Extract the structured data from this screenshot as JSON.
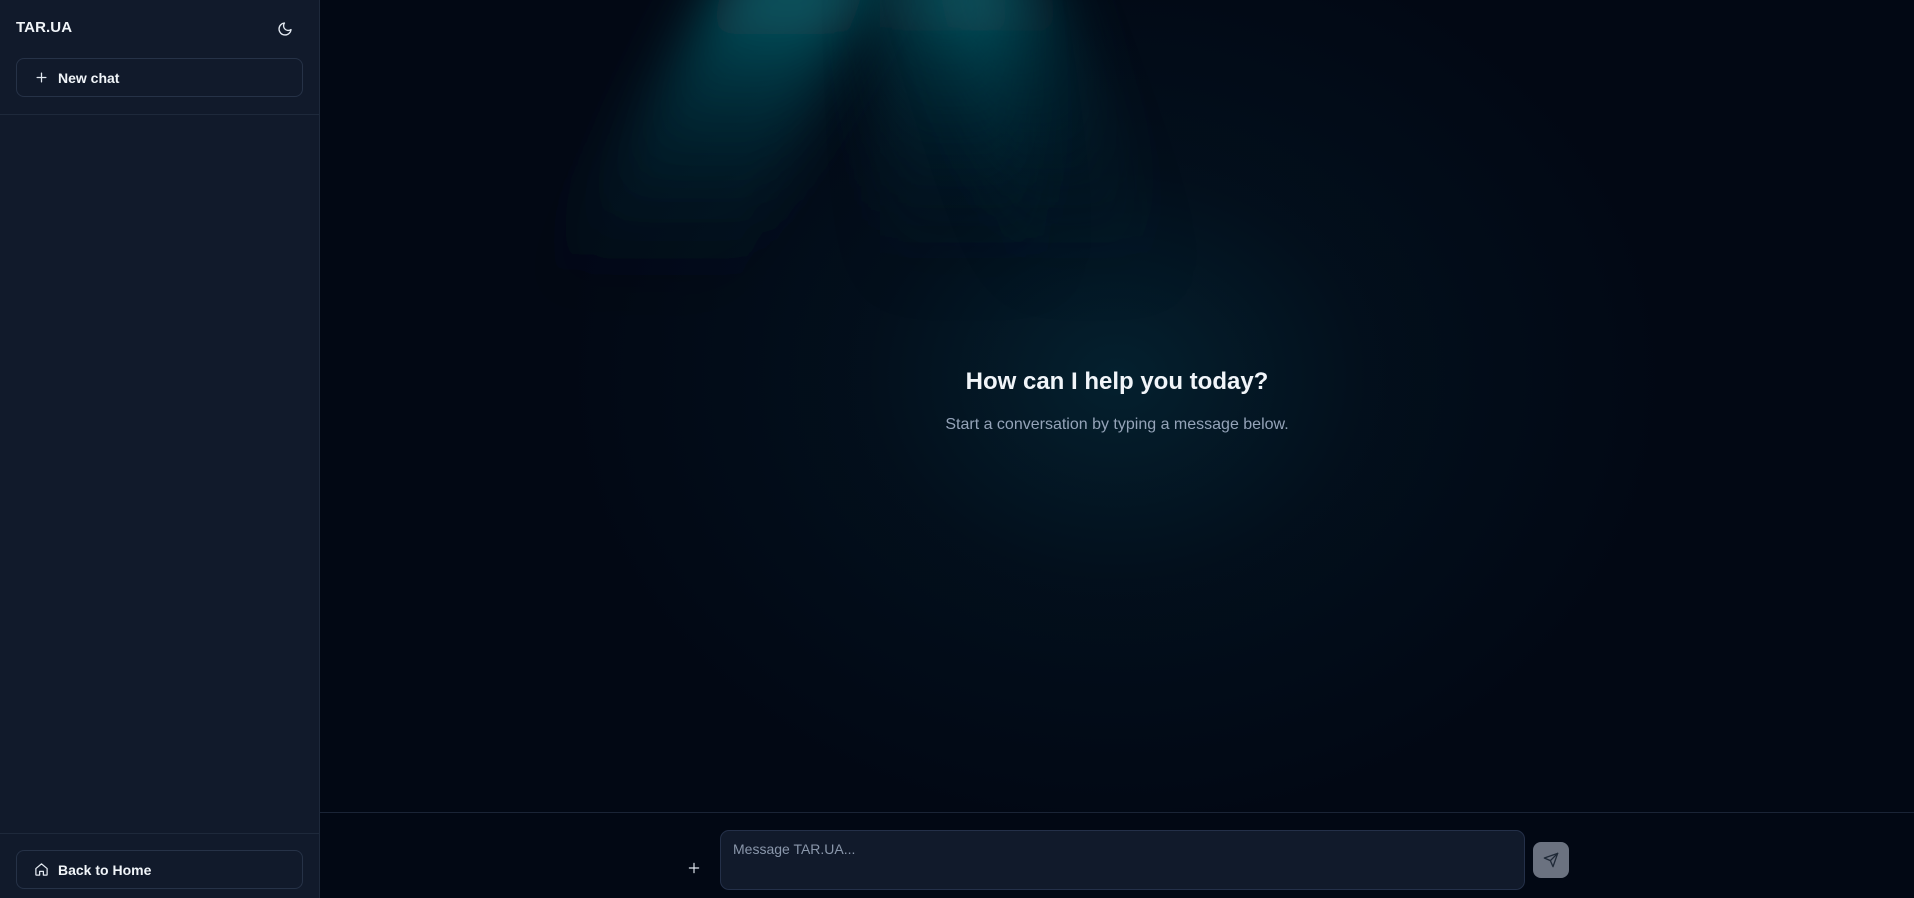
{
  "app": {
    "brand": "TAR.UA"
  },
  "sidebar": {
    "new_chat_label": "New chat",
    "back_home_label": "Back to Home",
    "icons": {
      "theme_toggle": "moon-icon",
      "new_chat": "plus-icon",
      "back_home": "home-icon"
    }
  },
  "main": {
    "title": "How can I help you today?",
    "subtitle": "Start a conversation by typing a message below."
  },
  "composer": {
    "placeholder": "Message TAR.UA...",
    "value": "",
    "icons": {
      "attach": "plus-icon",
      "send": "send-icon"
    }
  },
  "colors": {
    "sidebar_bg": "#111a2b",
    "main_bg": "#020814",
    "beam": "#0e7c86",
    "send_button": "#6b7280"
  }
}
